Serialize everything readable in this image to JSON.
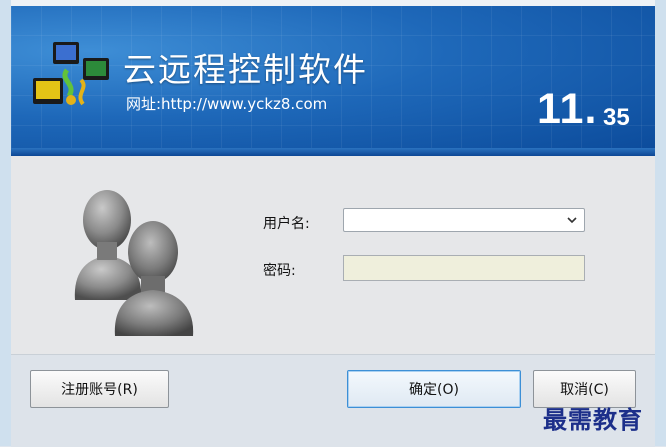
{
  "banner": {
    "app_title": "云远程控制软件",
    "url_text": "网址:http://www.yckz8.com",
    "version_major": "11.",
    "version_minor": "35"
  },
  "form": {
    "username_label": "用户名:",
    "username_value": "",
    "password_label": "密码:",
    "password_value": ""
  },
  "buttons": {
    "register": "注册账号(R)",
    "confirm": "确定(O)",
    "cancel": "取消(C)"
  },
  "watermark": "最需教育",
  "colors": {
    "banner_blue": "#1e68b9",
    "password_bg": "#efefdc",
    "confirm_border": "#3c8fd6",
    "watermark": "#1c2f8a"
  },
  "icons": [
    "network-computers-logo-icon",
    "users-avatar-icon",
    "chevron-down-icon"
  ]
}
